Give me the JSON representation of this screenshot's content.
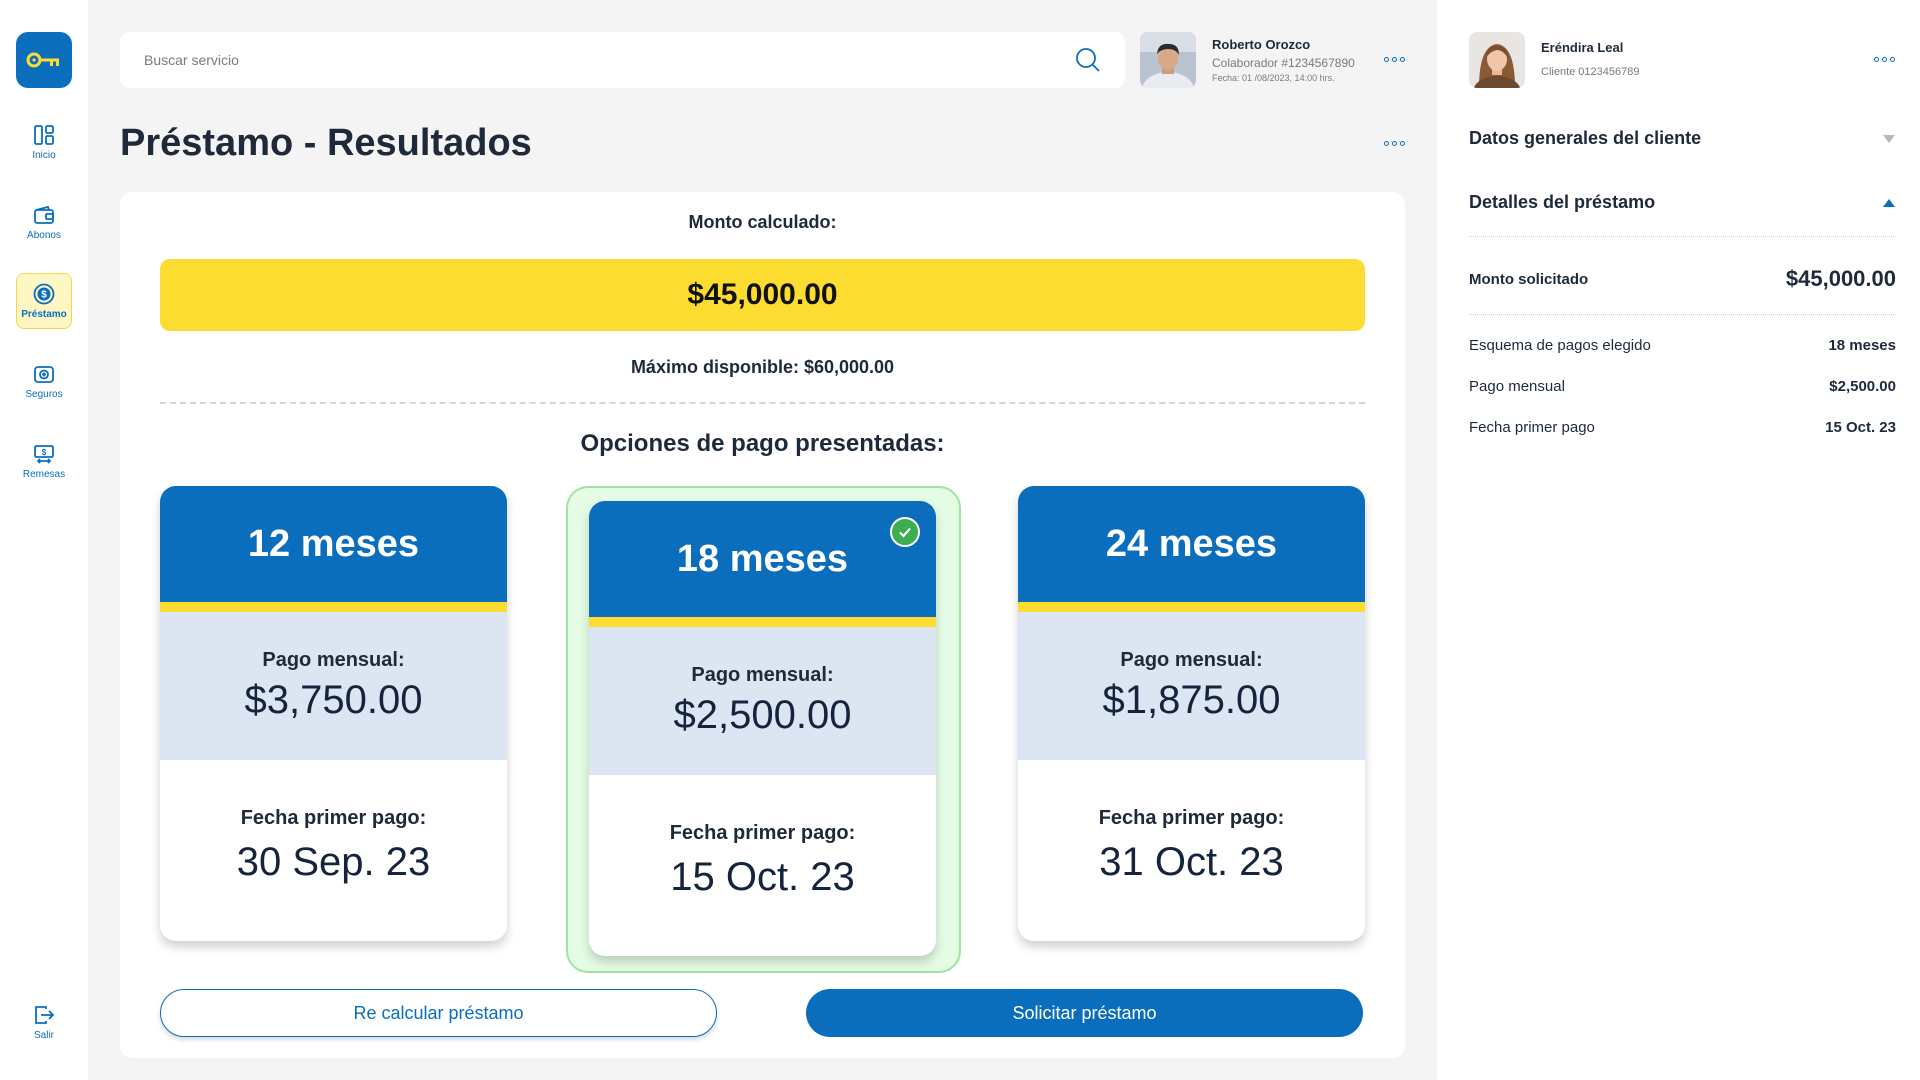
{
  "sidebar": {
    "items": [
      {
        "label": "Inicio",
        "icon": "dashboard-icon"
      },
      {
        "label": "Abonos",
        "icon": "wallet-icon"
      },
      {
        "label": "Préstamo",
        "icon": "dollar-coin-icon"
      },
      {
        "label": "Seguros",
        "icon": "insurance-icon"
      },
      {
        "label": "Remesas",
        "icon": "money-transfer-icon"
      }
    ],
    "logout_label": "Salir"
  },
  "search": {
    "placeholder": "Buscar servicio"
  },
  "collaborator": {
    "name": "Roberto Orozco",
    "id_text": "Colaborador #1234567890",
    "date_text": "Fecha: 01 /08/2023, 14:00 hrs."
  },
  "page": {
    "title": "Préstamo - Resultados"
  },
  "loan": {
    "calc_label": "Monto calculado:",
    "amount": "$45,000.00",
    "max_text": "Máximo disponible: $60,000.00",
    "options_title": "Opciones de pago presentadas:",
    "monthly_label": "Pago mensual:",
    "first_payment_label": "Fecha primer pago:",
    "options": [
      {
        "term": "12 meses",
        "monthly": "$3,750.00",
        "first_date": "30 Sep. 23"
      },
      {
        "term": "18 meses",
        "monthly": "$2,500.00",
        "first_date": "15 Oct. 23",
        "selected": true
      },
      {
        "term": "24 meses",
        "monthly": "$1,875.00",
        "first_date": "31 Oct. 23"
      }
    ],
    "recalc_label": "Re calcular préstamo",
    "request_label": "Solicitar préstamo"
  },
  "client": {
    "name": "Eréndira Leal",
    "id_text": "Cliente 0123456789",
    "general_section": "Datos generales del cliente",
    "details_section": "Detalles del préstamo",
    "requested_label": "Monto solicitado",
    "requested_value": "$45,000.00",
    "details": [
      {
        "label": "Esquema de pagos elegido",
        "value": "18 meses"
      },
      {
        "label": "Pago mensual",
        "value": "$2,500.00"
      },
      {
        "label": "Fecha primer pago",
        "value": "15 Oct. 23"
      }
    ]
  },
  "colors": {
    "primary": "#0a6ebd",
    "accent": "#fddc32",
    "selected_bg": "#e4fce4",
    "success": "#3cae4f"
  }
}
